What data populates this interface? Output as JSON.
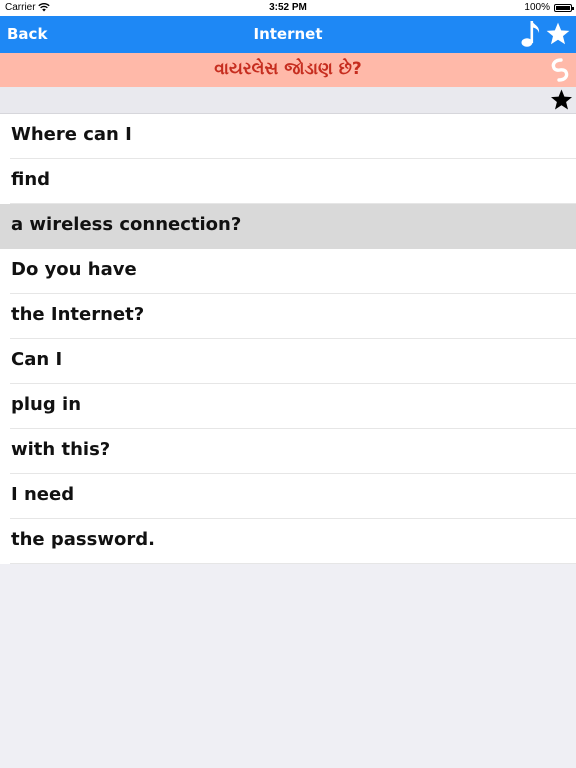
{
  "status_bar": {
    "carrier": "Carrier",
    "time": "3:52 PM",
    "battery": "100%"
  },
  "nav": {
    "back_label": "Back",
    "title": "Internet"
  },
  "translation": {
    "text": "વાયરલેસ જોડાણ છે?"
  },
  "phrases": [
    {
      "text": "Where can I",
      "selected": false
    },
    {
      "text": "find",
      "selected": false
    },
    {
      "text": "a wireless connection?",
      "selected": true
    },
    {
      "text": "Do you have",
      "selected": false
    },
    {
      "text": "the Internet?",
      "selected": false
    },
    {
      "text": "Can I",
      "selected": false
    },
    {
      "text": "plug in",
      "selected": false
    },
    {
      "text": "with this?",
      "selected": false
    },
    {
      "text": "I need",
      "selected": false
    },
    {
      "text": "the password.",
      "selected": false
    }
  ],
  "colors": {
    "nav_bg": "#1e88f5",
    "translation_bg": "#ffb9a9",
    "translation_text": "#c62d1f",
    "selected_row": "#d9d9d9"
  },
  "icons": {
    "nav_right": [
      "music-note-icon",
      "star-icon"
    ],
    "translation_right": "shazam-icon",
    "favorite": "star-icon"
  }
}
